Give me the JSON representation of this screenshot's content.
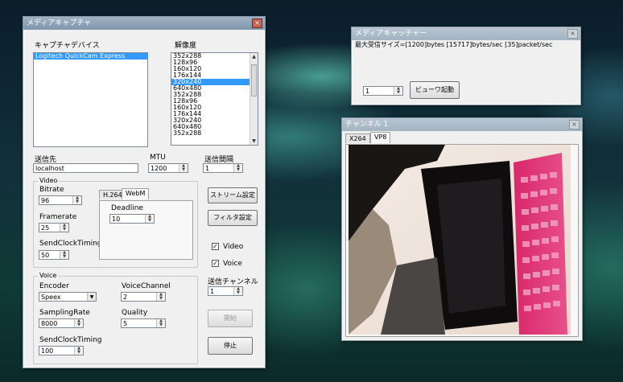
{
  "capture_window": {
    "title": "メディアキャプチャ",
    "device_label": "キャプチャデバイス",
    "resolution_label": "解像度",
    "devices": [
      "Logitech QuickCam Express"
    ],
    "resolutions": [
      "352x288",
      "128x96",
      "160x120",
      "176x144",
      "320x240",
      "640x480",
      "352x288",
      "128x96",
      "160x120",
      "176x144",
      "320x240",
      "640x480",
      "352x288"
    ],
    "selected_resolution_index": 4,
    "dest_label": "送信先",
    "dest_value": "localhost",
    "mtu_label": "MTU",
    "mtu_value": "1200",
    "interval_label": "送信間隔",
    "interval_value": "1",
    "video_group": "Video",
    "bitrate_label": "Bitrate",
    "bitrate_value": "96",
    "framerate_label": "Framerate",
    "framerate_value": "25",
    "sendclock_label": "SendClockTiming",
    "sendclock_value": "50",
    "tab_h264": "H.264",
    "tab_webm": "WebM",
    "deadline_label": "Deadline",
    "deadline_value": "10",
    "stream_settings_btn": "ストリーム設定",
    "filter_settings_btn": "フィルタ設定",
    "video_check_label": "Video",
    "voice_check_label": "Voice",
    "send_channel_label": "送信チャンネル",
    "send_channel_value": "1",
    "voice_group": "Voice",
    "encoder_label": "Encoder",
    "encoder_value": "Speex",
    "voice_channel_label": "VoiceChannel",
    "voice_channel_value": "2",
    "sampling_label": "SamplingRate",
    "sampling_value": "8000",
    "quality_label": "Quality",
    "quality_value": "5",
    "voice_sendclock_label": "SendClockTiming",
    "voice_sendclock_value": "100",
    "start_btn": "開始",
    "stop_btn": "停止"
  },
  "catcher_window": {
    "title": "メディアキャッチャー",
    "status": "最大受信サイズ=[1200]bytes [15717]bytes/sec [35]packet/sec",
    "channel_value": "1",
    "viewer_btn": "ビューワ起動"
  },
  "channel_window": {
    "title": "チャンネル 1",
    "tab_x264": "X264",
    "tab_vp8": "VP8"
  },
  "icons": {
    "close": "×",
    "up": "▲",
    "down": "▼",
    "check": "✓"
  }
}
